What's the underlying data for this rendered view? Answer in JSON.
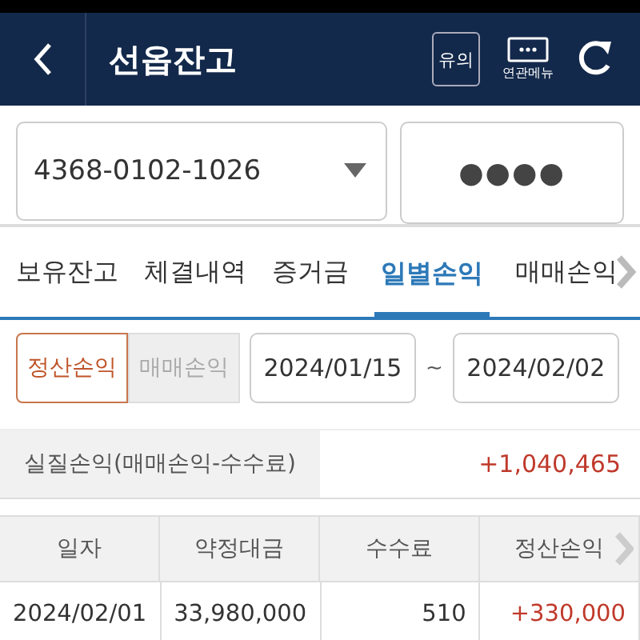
{
  "header": {
    "title": "선옵잔고",
    "notice_button": "유의",
    "related_menu": "연관메뉴"
  },
  "account": {
    "number": "4368-0102-1026",
    "password_mask": "●●●●"
  },
  "tabs": [
    {
      "label": "보유잔고",
      "selected": false
    },
    {
      "label": "체결내역",
      "selected": false
    },
    {
      "label": "증거금",
      "selected": false
    },
    {
      "label": "일별손익",
      "selected": true
    },
    {
      "label": "매매손익",
      "selected": false
    }
  ],
  "toggle": [
    {
      "label": "정산손익",
      "selected": true
    },
    {
      "label": "매매손익",
      "selected": false
    }
  ],
  "date_range": {
    "from": "2024/01/15",
    "separator": "~",
    "to": "2024/02/02"
  },
  "summary": {
    "label": "실질손익(매매손익-수수료)",
    "value": "+1,040,465"
  },
  "table": {
    "columns": [
      "일자",
      "약정대금",
      "수수료",
      "정산손익"
    ],
    "rows": [
      [
        "2024/02/01",
        "33,980,000",
        "510",
        "+330,000"
      ]
    ]
  }
}
